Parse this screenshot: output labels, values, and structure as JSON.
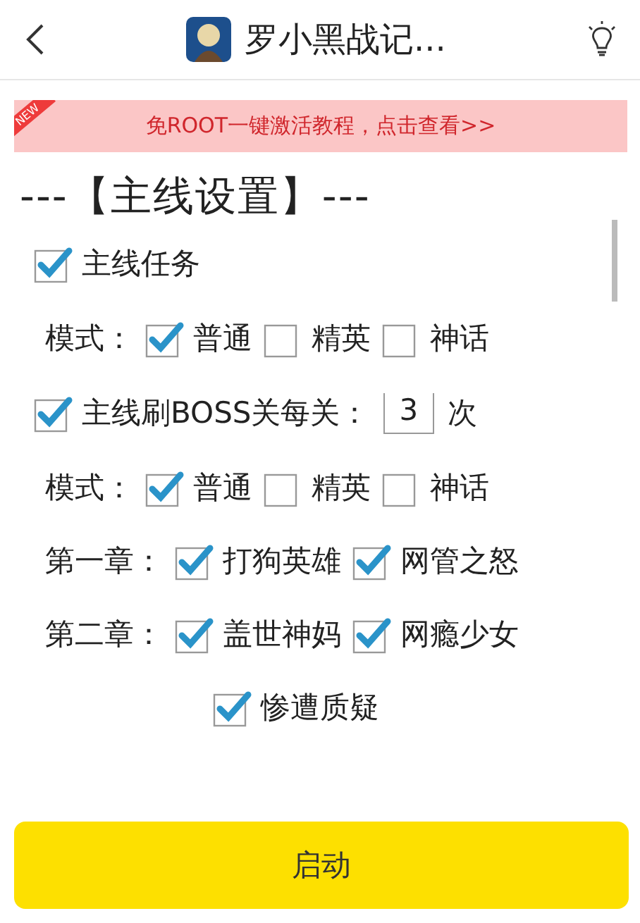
{
  "header": {
    "title": "罗小黑战记..."
  },
  "banner": {
    "badge": "NEW",
    "text": "免ROOT一键激活教程，点击查看>>"
  },
  "section_title": "---【主线设置】---",
  "rows": [
    {
      "kind": "check",
      "label": "主线任务",
      "checked": true
    },
    {
      "kind": "group",
      "label": "模式：",
      "options": [
        {
          "label": "普通",
          "checked": true
        },
        {
          "label": "精英",
          "checked": false
        },
        {
          "label": "神话",
          "checked": false
        }
      ]
    },
    {
      "kind": "count",
      "label": "主线刷BOSS关每关：",
      "checked": true,
      "value": "3",
      "unit": "次"
    },
    {
      "kind": "group",
      "label": "模式：",
      "options": [
        {
          "label": "普通",
          "checked": true
        },
        {
          "label": "精英",
          "checked": false
        },
        {
          "label": "神话",
          "checked": false
        }
      ]
    },
    {
      "kind": "group",
      "label": "第一章：",
      "options": [
        {
          "label": "打狗英雄",
          "checked": true
        },
        {
          "label": "网管之怒",
          "checked": true
        }
      ]
    },
    {
      "kind": "group",
      "label": "第二章：",
      "options": [
        {
          "label": "盖世神妈",
          "checked": true
        },
        {
          "label": "网瘾少女",
          "checked": true
        }
      ]
    },
    {
      "kind": "centered",
      "options": [
        {
          "label": "惨遭质疑",
          "checked": true
        }
      ]
    }
  ],
  "start_button": "启动"
}
